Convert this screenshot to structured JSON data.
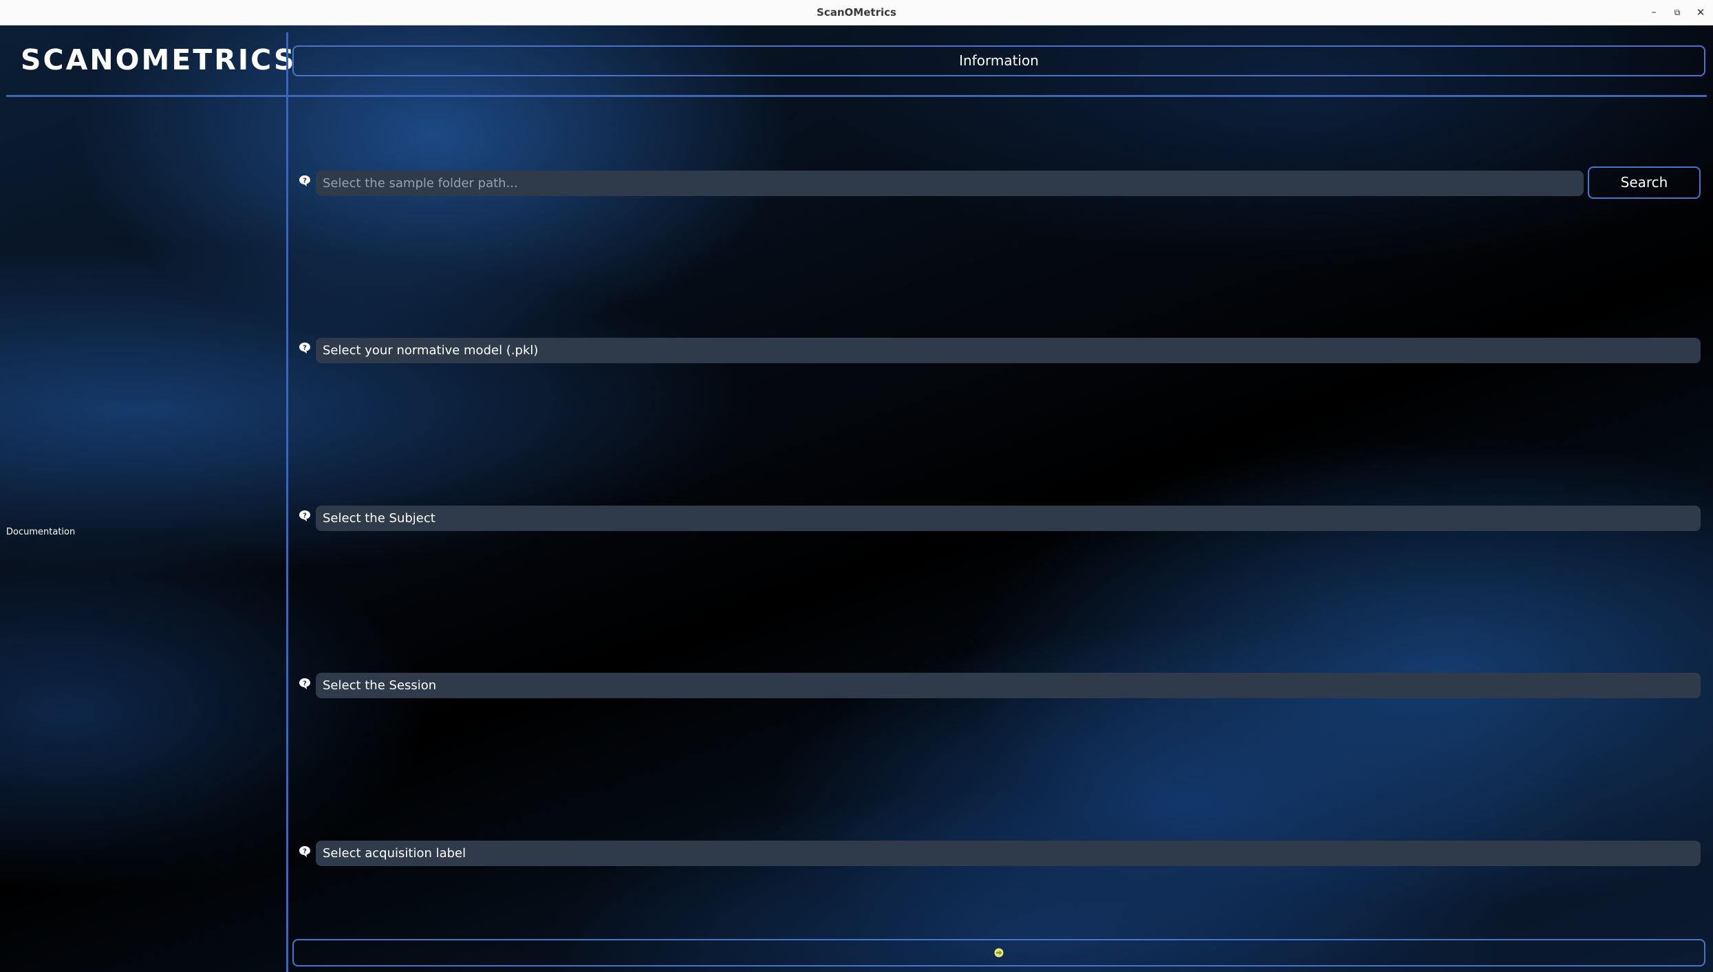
{
  "window": {
    "title": "ScanOMetrics",
    "minimize_glyph": "–",
    "maximize_glyph": "⧉",
    "close_glyph": "✕"
  },
  "header": {
    "brand": "SCANOMETRICS",
    "info_button_label": "Information"
  },
  "sidebar": {
    "documentation_link": "Documentation"
  },
  "form": {
    "sample_folder": {
      "placeholder": "Select the sample folder path...",
      "value": "",
      "search_label": "Search",
      "help_icon": "question-bubble-icon"
    },
    "normative_model": {
      "label": "Select your normative model (.pkl)",
      "help_icon": "question-bubble-icon"
    },
    "subject": {
      "label": "Select the Subject",
      "help_icon": "question-bubble-icon"
    },
    "session": {
      "label": "Select the Session",
      "help_icon": "question-bubble-icon"
    },
    "acquisition": {
      "label": "Select acquisition label",
      "help_icon": "question-bubble-icon"
    }
  },
  "footer": {
    "next_icon": "green-arrow-right-icon"
  },
  "colors": {
    "accent_border": "#4a74c9",
    "divider": "#3d66b5",
    "field_bg": "#2f3b4b",
    "next_arrow": "#8bc34a"
  }
}
